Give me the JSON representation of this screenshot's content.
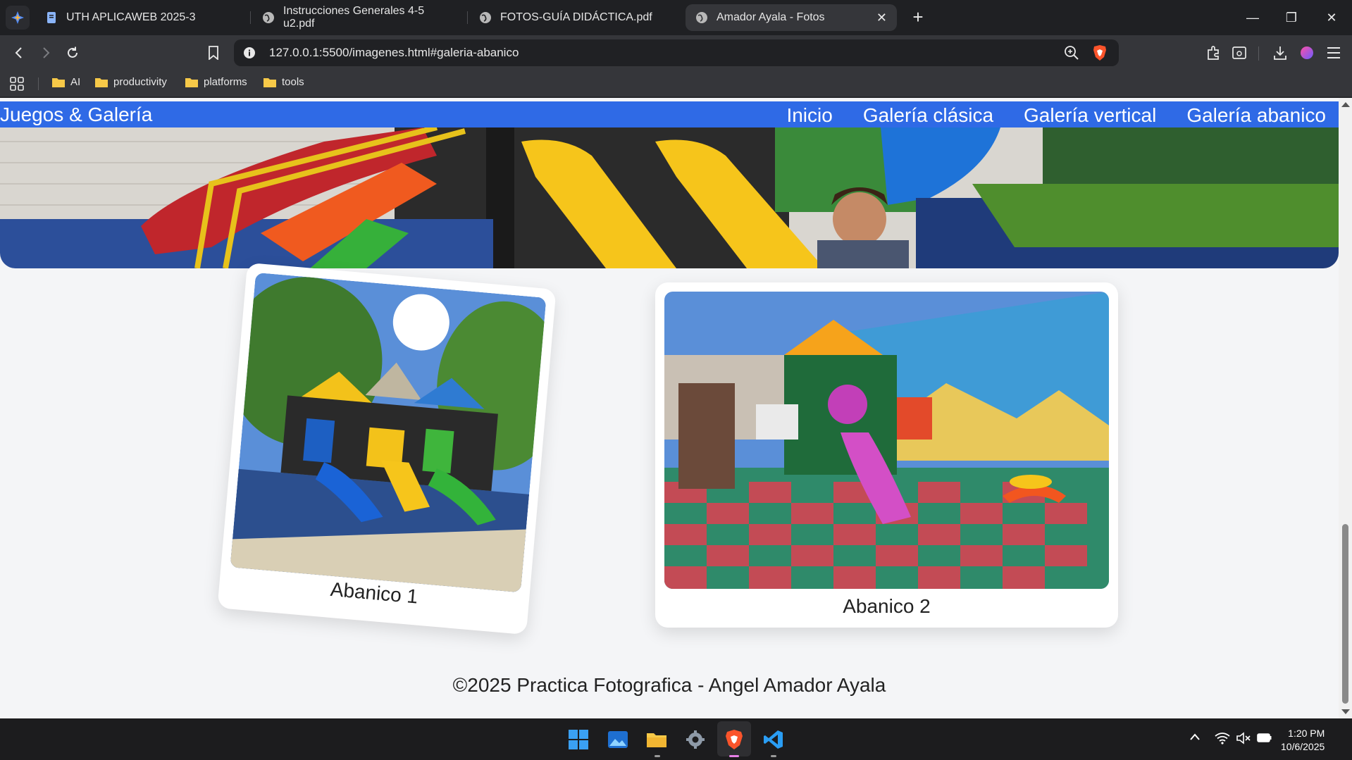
{
  "browser": {
    "tabs": [
      {
        "title": "UTH APLICAWEB 2025-3"
      },
      {
        "title": "Instrucciones Generales 4-5 u2.pdf"
      },
      {
        "title": "FOTOS-GUÍA DIDÁCTICA.pdf"
      },
      {
        "title": "Amador Ayala - Fotos"
      }
    ],
    "address": "127.0.0.1:5500/imagenes.html#galeria-abanico",
    "bookmarks": [
      "AI",
      "productivity",
      "platforms",
      "tools"
    ]
  },
  "site": {
    "brand": "Juegos & Galería",
    "nav": [
      "Inicio",
      "Galería clásica",
      "Galería vertical",
      "Galería abanico"
    ],
    "cards": [
      {
        "caption": "Abanico 1"
      },
      {
        "caption": "Abanico 2"
      }
    ],
    "footer": "©2025 Practica Fotografica - Angel Amador Ayala"
  },
  "taskbar": {
    "time": "1:20 PM",
    "date": "10/6/2025"
  },
  "colors": {
    "header_blue": "#2f6ae6",
    "page_bg": "#f4f5f7"
  }
}
